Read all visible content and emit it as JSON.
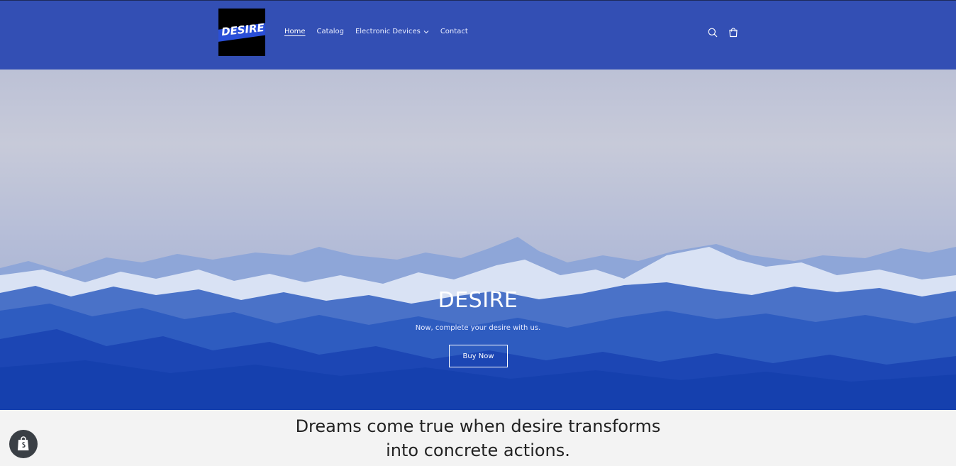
{
  "brand": {
    "logo_text": "DESIRE"
  },
  "nav": {
    "items": [
      {
        "label": "Home",
        "active": true
      },
      {
        "label": "Catalog"
      },
      {
        "label": "Electronic Devices",
        "dropdown": true
      },
      {
        "label": "Contact"
      }
    ]
  },
  "header_icons": [
    "search-icon",
    "cart-icon"
  ],
  "hero": {
    "title": "DESIRE",
    "subtitle": "Now, complete your desire with us.",
    "button_label": "Buy Now"
  },
  "tagline": {
    "line1": "Dreams come true when desire transforms",
    "line2": "into concrete actions."
  },
  "colors": {
    "header_bg": "#334fb4",
    "page_bg": "#f3f3f3",
    "hero_blue": "#1a44b0"
  }
}
